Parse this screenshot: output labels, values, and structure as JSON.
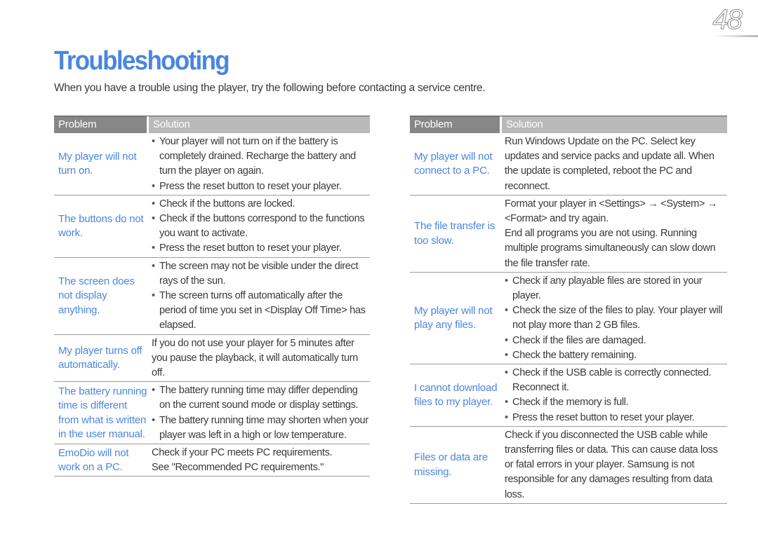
{
  "page_number": "48",
  "title": "Troubleshooting",
  "intro": "When you have a trouble using the player, try the following before contacting a service centre.",
  "colors": {
    "accent": "#4a86e0",
    "header_dark": "#878787",
    "header_light": "#b9b9b9",
    "text": "#3a3a3a"
  },
  "tables": [
    {
      "headers": {
        "problem": "Problem",
        "solution": "Solution"
      },
      "rows": [
        {
          "problem": "My player will not turn on.",
          "type": "bullets",
          "solution": [
            "Your player will not turn on if the battery is completely drained. Recharge the battery and turn the player on again.",
            "Press the reset button to reset your player."
          ]
        },
        {
          "problem": "The buttons do not work.",
          "type": "bullets",
          "solution": [
            "Check if the buttons are locked.",
            "Check if the buttons correspond to the functions you want to activate.",
            "Press the reset button to reset your player."
          ]
        },
        {
          "problem": "The screen does not display anything.",
          "type": "bullets",
          "solution": [
            "The screen may not be visible under the direct rays of the sun.",
            "The screen turns off automatically after the period of time you set in <Display Off Time> has elapsed."
          ]
        },
        {
          "problem": "My player turns off automatically.",
          "type": "paragraphs",
          "solution": [
            "If you do not use your player for 5 minutes after you pause the playback, it will automatically turn off."
          ]
        },
        {
          "problem": "The battery running time is different from what is written in the user manual.",
          "type": "bullets",
          "solution": [
            "The battery running time may differ depending on the current sound mode or display settings.",
            "The battery running time may shorten when your player was left in a high or low temperature."
          ]
        },
        {
          "problem": "EmoDio will not work on a PC.",
          "type": "paragraphs",
          "solution": [
            "Check if your PC meets PC requirements.",
            "See \"Recommended PC requirements.\""
          ]
        }
      ]
    },
    {
      "headers": {
        "problem": "Problem",
        "solution": "Solution"
      },
      "rows": [
        {
          "problem": "My player will not connect to a PC.",
          "type": "paragraphs",
          "solution": [
            "Run Windows Update on the PC. Select key updates and service packs and update all. When the update is completed, reboot the PC and reconnect."
          ]
        },
        {
          "problem": "The file transfer is too slow.",
          "type": "paragraphs",
          "solution": [
            "Format your player in <Settings> → <System> → <Format> and try again.",
            "End all programs you are not using. Running multiple programs simultaneously can slow down the file transfer rate."
          ]
        },
        {
          "problem": "My player will not play any files.",
          "type": "bullets",
          "solution": [
            "Check if any playable files are stored in your player.",
            "Check the size of the files to play. Your player will not play more than 2 GB files.",
            "Check if the files are damaged.",
            "Check the battery remaining."
          ]
        },
        {
          "problem": "I cannot download files to my player.",
          "type": "bullets",
          "solution": [
            "Check if the USB cable is correctly connected. Reconnect it.",
            "Check if the memory is full.",
            "Press the reset button to reset your player."
          ]
        },
        {
          "problem": "Files or data are missing.",
          "type": "paragraphs",
          "solution": [
            "Check if you disconnected the USB cable while transferring files or data. This can cause data loss or fatal errors in your player. Samsung is not responsible for any damages resulting from data loss."
          ]
        }
      ]
    }
  ]
}
